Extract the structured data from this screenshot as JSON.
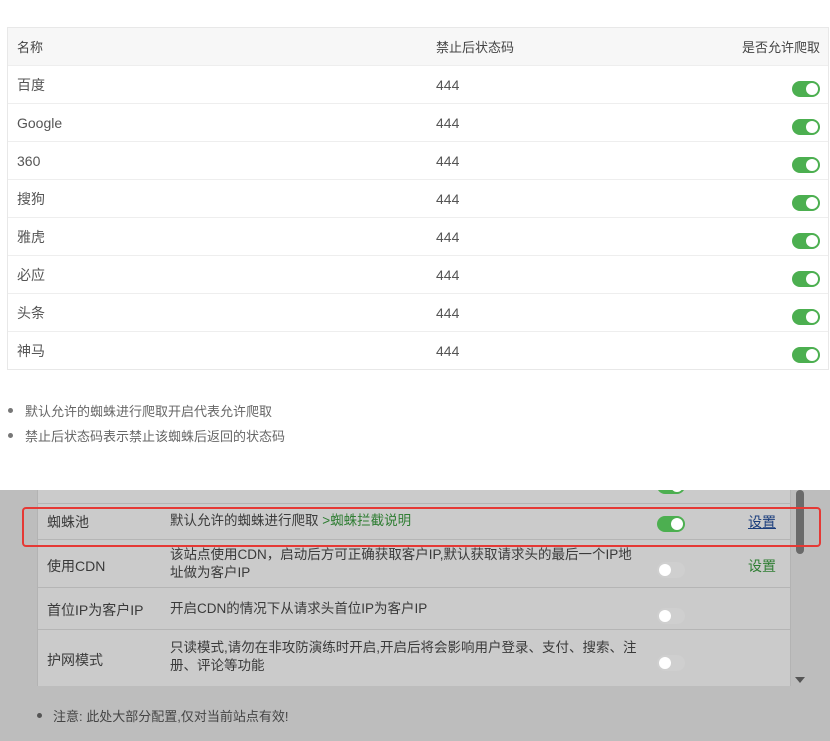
{
  "table": {
    "headers": {
      "name": "名称",
      "code": "禁止后状态码",
      "allow": "是否允许爬取"
    },
    "rows": [
      {
        "name": "百度",
        "code": "444",
        "allowed": true
      },
      {
        "name": "Google",
        "code": "444",
        "allowed": true
      },
      {
        "name": "360",
        "code": "444",
        "allowed": true
      },
      {
        "name": "搜狗",
        "code": "444",
        "allowed": true
      },
      {
        "name": "雅虎",
        "code": "444",
        "allowed": true
      },
      {
        "name": "必应",
        "code": "444",
        "allowed": true
      },
      {
        "name": "头条",
        "code": "444",
        "allowed": true
      },
      {
        "name": "神马",
        "code": "444",
        "allowed": true
      }
    ]
  },
  "notes": [
    "默认允许的蜘蛛进行爬取开启代表允许爬取",
    "禁止后状态码表示禁止该蜘蛛后返回的状态码"
  ],
  "settings": {
    "rows": [
      {
        "name": "蜘蛛池",
        "desc": "默认允许的蜘蛛进行爬取 ",
        "link": ">蜘蛛拦截说明",
        "enabled": true,
        "action": "设置"
      },
      {
        "name": "使用CDN",
        "desc": "该站点使用CDN，启动后方可正确获取客户IP,默认获取请求头的最后一个IP地址做为客户IP",
        "link": "",
        "enabled": false,
        "action": "设置"
      },
      {
        "name": "首位IP为客户IP",
        "desc": "开启CDN的情况下从请求头首位IP为客户IP",
        "link": "",
        "enabled": false,
        "action": ""
      },
      {
        "name": "护网模式",
        "desc": "只读模式,请勿在非攻防演练时开启,开启后将会影响用户登录、支付、搜索、注册、评论等功能",
        "link": "",
        "enabled": false,
        "action": ""
      }
    ],
    "note": "注意: 此处大部分配置,仅对当前站点有效!"
  },
  "colors": {
    "switch_on": "#4caf50",
    "switch_off": "#cfcfcf",
    "highlight": "#e53935",
    "link_green": "#2e7d32"
  }
}
